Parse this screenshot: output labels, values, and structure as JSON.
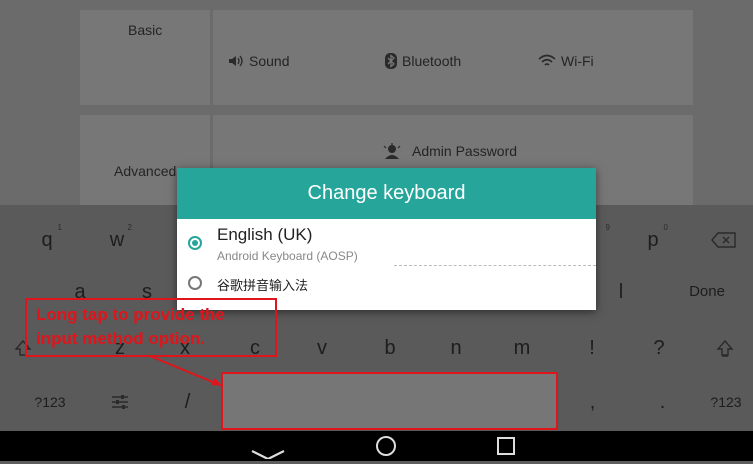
{
  "settings": {
    "basic_label": "Basic",
    "advanced_label": "Advanced",
    "sound_label": "Sound",
    "bluetooth_label": "Bluetooth",
    "wifi_label": "Wi-Fi",
    "admin_password_label": "Admin Password"
  },
  "keyboard": {
    "row1": [
      {
        "label": "q",
        "hint": "1"
      },
      {
        "label": "w",
        "hint": "2"
      },
      {
        "label": "p",
        "hint": "0"
      }
    ],
    "row1_hidden_hint": "9",
    "row2": [
      "a",
      "s",
      "l"
    ],
    "done_label": "Done",
    "row3": [
      "z",
      "x",
      "c",
      "v",
      "b",
      "n",
      "m",
      "!",
      "?"
    ],
    "row4": {
      "symbols_left": "?123",
      "slash": "/",
      "comma": ",",
      "period": ".",
      "symbols_right": "?123"
    }
  },
  "dialog": {
    "title": "Change keyboard",
    "options": [
      {
        "title": "English (UK)",
        "subtitle": "Android Keyboard (AOSP)",
        "selected": true
      },
      {
        "title": "谷歌拼音输入法",
        "selected": false
      }
    ]
  },
  "annotation": {
    "line1": "Long tap to provide the",
    "line2": "input method option."
  },
  "colors": {
    "accent": "#26a69a",
    "annotation": "#e0151b"
  }
}
